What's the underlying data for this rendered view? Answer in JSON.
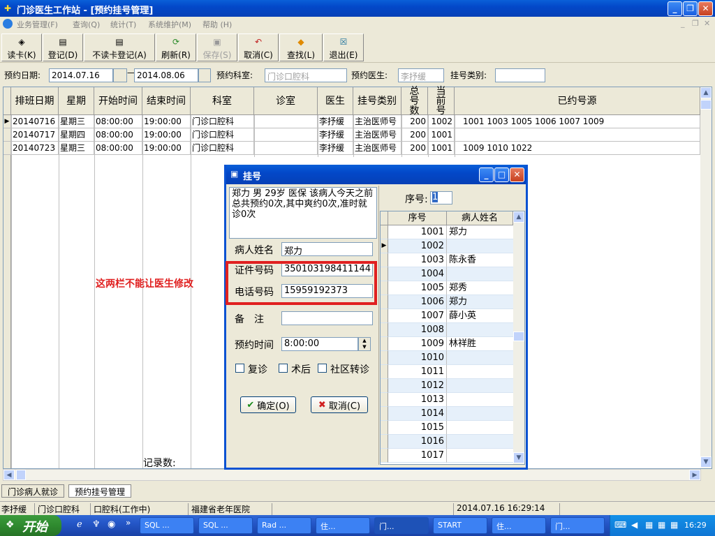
{
  "window": {
    "title": "门诊医生工作站 - [预约挂号管理]"
  },
  "menu": [
    "业务管理(F)",
    "查询(Q)",
    "统计(T)",
    "系统维护(M)",
    "帮助 (H)"
  ],
  "toolbar": [
    {
      "label": "读卡(K)",
      "icon": "card-icon",
      "enabled": true
    },
    {
      "label": "登记(D)",
      "icon": "book-icon",
      "enabled": true
    },
    {
      "label": "不读卡登记(A)",
      "icon": "book-icon",
      "enabled": true
    },
    {
      "label": "刷新(R)",
      "icon": "refresh-icon",
      "enabled": true
    },
    {
      "label": "保存(S)",
      "icon": "save-icon",
      "enabled": false
    },
    {
      "label": "取消(C)",
      "icon": "undo-icon",
      "enabled": true
    },
    {
      "label": "查找(L)",
      "icon": "eraser-icon",
      "enabled": true
    },
    {
      "label": "退出(E)",
      "icon": "exit-icon",
      "enabled": true
    }
  ],
  "filter": {
    "date_label": "预约日期:",
    "date_from": "2014.07.16",
    "date_to": "2014.08.06",
    "dept_label": "预约科室:",
    "dept_value": "门诊口腔科",
    "doctor_label": "预约医生:",
    "doctor_value": "李抒缓",
    "type_label": "挂号类别:",
    "type_value": ""
  },
  "grid": {
    "columns": [
      "排班日期",
      "星期",
      "开始时间",
      "结束时间",
      "科室",
      "诊室",
      "医生",
      "挂号类别",
      "总号数",
      "当前号",
      "已约号源"
    ],
    "rows": [
      [
        "20140716",
        "星期三",
        "08:00:00",
        "19:00:00",
        "门诊口腔科",
        "",
        "李抒缓",
        "主治医师号",
        "200",
        "1002",
        "1001 1003 1005 1006 1007 1009"
      ],
      [
        "20140717",
        "星期四",
        "08:00:00",
        "19:00:00",
        "门诊口腔科",
        "",
        "李抒缓",
        "主治医师号",
        "200",
        "1001",
        ""
      ],
      [
        "20140723",
        "星期三",
        "08:00:00",
        "19:00:00",
        "门诊口腔科",
        "",
        "李抒缓",
        "主治医师号",
        "200",
        "1001",
        "1009 1010 1022"
      ]
    ],
    "footer_label": "记录数:"
  },
  "annotation": "这两栏不能让医生修改",
  "dialog": {
    "title": "挂号",
    "info_text": "郑力 男 29岁 医保 该病人今天之前总共预约0次,其中爽约0次,准时就诊0次",
    "name_label": "病人姓名",
    "name_value": "郑力",
    "id_label": "证件号码",
    "id_value": "350103198411144",
    "phone_label": "电话号码",
    "phone_value": "15959192373",
    "note_label": "备　注",
    "note_value": "",
    "time_label": "预约时间",
    "time_value": "8:00:00",
    "checks": [
      "复诊",
      "术后",
      "社区转诊"
    ],
    "ok_label": "确定(O)",
    "cancel_label": "取消(C)",
    "seq_label": "序号:",
    "seq_value": "1",
    "list_headers": [
      "序号",
      "病人姓名"
    ],
    "list_rows": [
      [
        "1001",
        "郑力"
      ],
      [
        "1002",
        ""
      ],
      [
        "1003",
        "陈永香"
      ],
      [
        "1004",
        ""
      ],
      [
        "1005",
        "郑秀"
      ],
      [
        "1006",
        "郑力"
      ],
      [
        "1007",
        "薛小英"
      ],
      [
        "1008",
        ""
      ],
      [
        "1009",
        "林祥胜"
      ],
      [
        "1010",
        ""
      ],
      [
        "1011",
        ""
      ],
      [
        "1012",
        ""
      ],
      [
        "1013",
        ""
      ],
      [
        "1014",
        ""
      ],
      [
        "1015",
        ""
      ],
      [
        "1016",
        ""
      ],
      [
        "1017",
        ""
      ]
    ]
  },
  "tabs": [
    "门诊病人就诊",
    "预约挂号管理"
  ],
  "status": [
    "李抒缓",
    "门诊口腔科",
    "口腔科(工作中)",
    "福建省老年医院",
    "",
    "2014.07.16 16:29:14"
  ],
  "taskbar": {
    "start": "开始",
    "tasks": [
      "SQL ...",
      "SQL ...",
      "Rad ...",
      "住...",
      "门...",
      "START",
      "住...",
      "门..."
    ],
    "clock": "16:29"
  }
}
